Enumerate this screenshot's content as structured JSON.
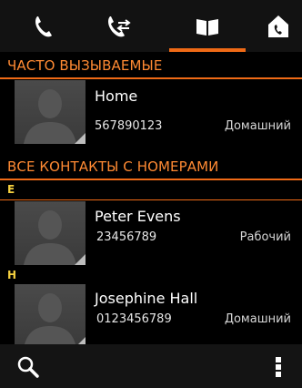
{
  "tabs": [
    {
      "icon": "phone-icon",
      "active": false
    },
    {
      "icon": "phone-transfer-icon",
      "active": false
    },
    {
      "icon": "phonebook-icon",
      "active": true
    },
    {
      "icon": "home-phone-icon",
      "active": false
    }
  ],
  "sections": {
    "frequent_title": "ЧАСТО ВЫЗЫВАЕМЫЕ",
    "all_title": "ВСЕ КОНТАКТЫ С НОМЕРАМИ"
  },
  "contacts": {
    "home": {
      "name": "Home",
      "number": "567890123",
      "type": "Домашний"
    },
    "letter_e": "E",
    "peter": {
      "name": "Peter Evens",
      "number": "23456789",
      "type": "Рабочий"
    },
    "letter_h": "H",
    "josephine": {
      "name": "Josephine Hall",
      "number": "0123456789",
      "type": "Домашний"
    }
  },
  "bottom": {
    "left_icon": "search-icon",
    "right_icon": "more-vertical-icon"
  },
  "colors": {
    "accent": "#ef6a16",
    "letter": "#f5d03f"
  }
}
